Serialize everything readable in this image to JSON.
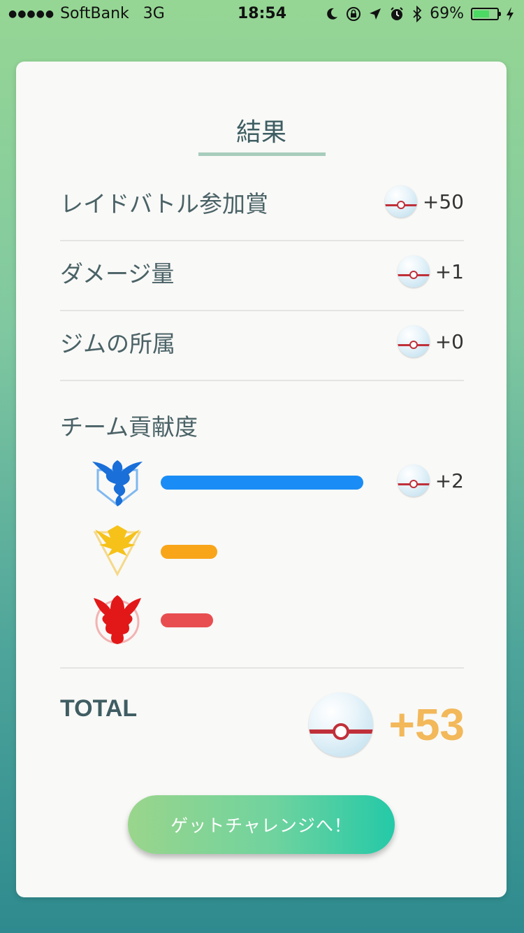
{
  "status_bar": {
    "signal": "●●●●●",
    "carrier": "SoftBank",
    "network": "3G",
    "time": "18:54",
    "battery_percent": "69%",
    "battery_level": 0.69
  },
  "result": {
    "title": "結果",
    "rows": [
      {
        "label": "レイドバトル参加賞",
        "value": "+50"
      },
      {
        "label": "ダメージ量",
        "value": "+1"
      },
      {
        "label": "ジムの所属",
        "value": "+0"
      }
    ],
    "team_contribution": {
      "heading": "チーム貢献度",
      "teams": [
        {
          "team": "mystic",
          "color": "#1a8cf5",
          "bar_level": 1.0,
          "value": "+2"
        },
        {
          "team": "instinct",
          "color": "#f8a51a",
          "bar_level": 0.28
        },
        {
          "team": "valor",
          "color": "#e84e50",
          "bar_level": 0.26
        }
      ]
    },
    "total": {
      "label": "TOTAL",
      "value": "+53"
    },
    "button_label": "ゲットチャレンジへ！"
  },
  "colors": {
    "accent": "#a8ccbc",
    "total": "#f2b85a",
    "ball_band": "#c0303a"
  }
}
